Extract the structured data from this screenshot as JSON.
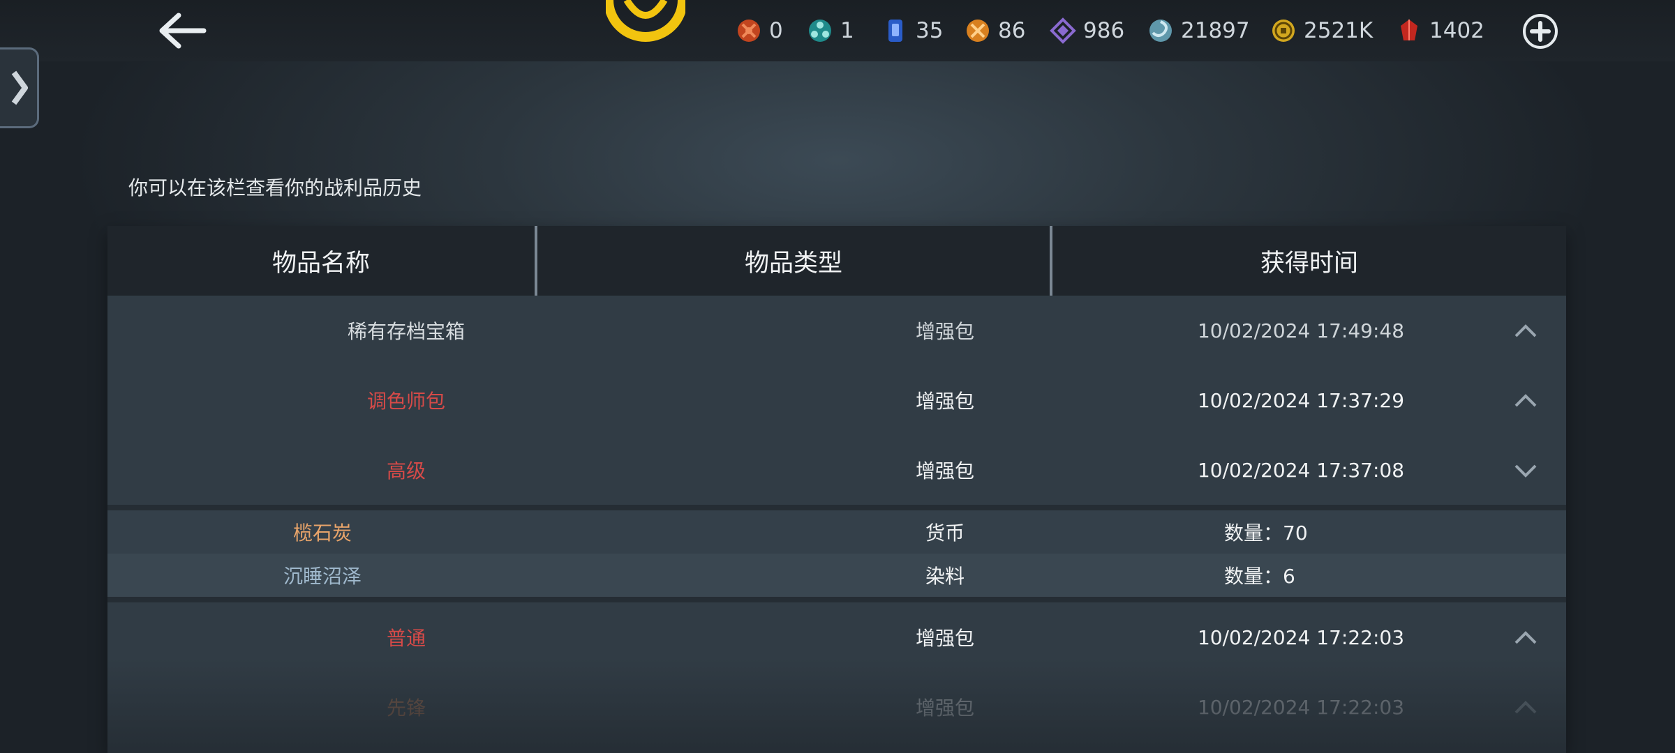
{
  "header": {
    "currencies": [
      {
        "icon": "red-orb-icon",
        "value": "0",
        "color": "#d2502e"
      },
      {
        "icon": "teal-orb-icon",
        "value": "1",
        "color": "#2aa8a8"
      },
      {
        "icon": "blue-card-icon",
        "value": "35",
        "color": "#3a6fd8"
      },
      {
        "icon": "orange-orb-icon",
        "value": "86",
        "color": "#e08a2c"
      },
      {
        "icon": "purple-diamond-icon",
        "value": "986",
        "color": "#8a6ad0"
      },
      {
        "icon": "cyan-swirl-icon",
        "value": "21897",
        "color": "#7fb3c4"
      },
      {
        "icon": "gold-coin-icon",
        "value": "2521K",
        "color": "#e3b92a"
      },
      {
        "icon": "red-gem-icon",
        "value": "1402",
        "color": "#d0302a"
      }
    ]
  },
  "subtitle": "你可以在该栏查看你的战利品历史",
  "table": {
    "headers": [
      "物品名称",
      "物品类型",
      "获得时间"
    ],
    "rows": [
      {
        "name": "稀有存档宝箱",
        "name_color": "#d8dde0",
        "type": "增强包",
        "time": "10/02/2024 17:49:48",
        "expanded": false
      },
      {
        "name": "调色师包",
        "name_color": "#d64a48",
        "type": "增强包",
        "time": "10/02/2024 17:37:29",
        "expanded": false
      },
      {
        "name": "高级",
        "name_color": "#d64a48",
        "type": "增强包",
        "time": "10/02/2024 17:37:08",
        "expanded": true
      },
      {
        "name": "普通",
        "name_color": "#d64a48",
        "type": "增强包",
        "time": "10/02/2024 17:22:03",
        "expanded": false
      },
      {
        "name": "先锋",
        "name_color": "#d07a4a",
        "type": "增强包",
        "time": "10/02/2024 17:22:03",
        "expanded": false
      }
    ],
    "subitems": [
      {
        "name": "榄石炭",
        "name_color": "#e8a46a",
        "type": "货币",
        "qty_label": "数量：70"
      },
      {
        "name": "沉睡沼泽",
        "name_color": "#9fb8cc",
        "type": "染料",
        "qty_label": "数量：6"
      }
    ]
  },
  "colors": {
    "accent_gold": "#f2c40f",
    "background": "#2c363e",
    "header_bar": "#1f252b"
  }
}
